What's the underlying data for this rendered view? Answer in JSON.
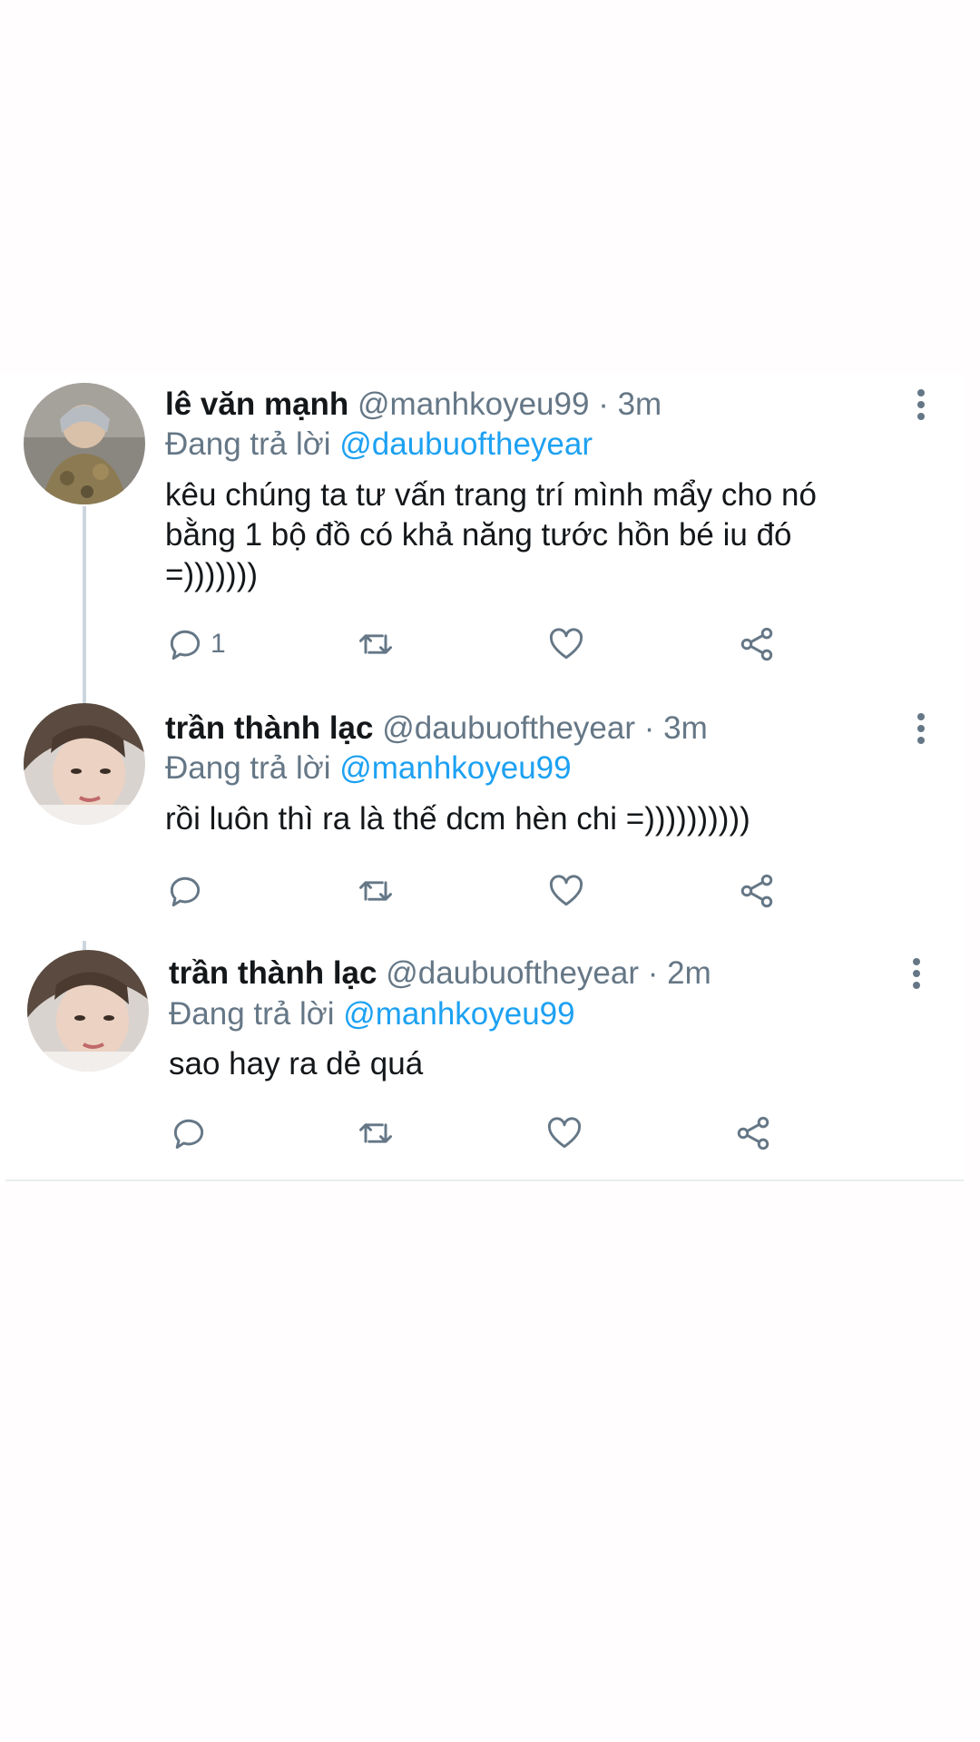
{
  "tweets": [
    {
      "name": "lê văn mạnh",
      "handle": "@manhkoyeu99",
      "separator": "·",
      "time": "3m",
      "reply_prefix": "Đang trả lời",
      "reply_to": "@daubuoftheyear",
      "lines": [
        "kêu chúng ta tư vấn trang trí mình mẩy cho nó",
        "bằng 1 bộ đồ có khả năng tước hồn bé iu đó",
        "=)))))))"
      ],
      "reply_count": "1"
    },
    {
      "name": "trần thành lạc",
      "handle": "@daubuoftheyear",
      "separator": "·",
      "time": "3m",
      "reply_prefix": "Đang trả lời",
      "reply_to": "@manhkoyeu99",
      "lines": [
        "rồi luôn thì ra là thế dcm hèn chi =))))))))))"
      ],
      "reply_count": ""
    },
    {
      "name": "trần thành lạc",
      "handle": "@daubuoftheyear",
      "separator": "·",
      "time": "2m",
      "reply_prefix": "Đang trả lời",
      "reply_to": "@manhkoyeu99",
      "lines": [
        "sao hay ra dẻ quá"
      ],
      "reply_count": ""
    }
  ],
  "icons": {
    "reply": "reply-bubble-icon",
    "retweet": "retweet-icon",
    "like": "heart-icon",
    "share": "share-icon",
    "more": "more-vertical-icon"
  },
  "colors": {
    "link": "#1da1f2",
    "secondary_text": "#657786",
    "primary_text": "#14171a",
    "thread_line": "#ccd6dd"
  }
}
